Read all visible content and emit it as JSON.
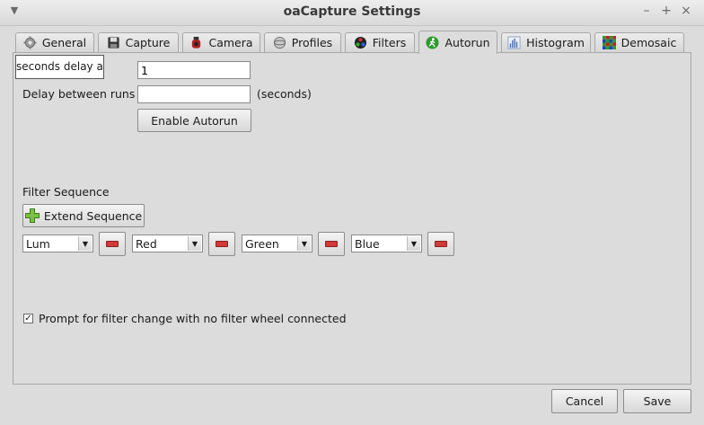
{
  "window": {
    "title": "oaCapture Settings"
  },
  "tabs": [
    {
      "label": "General",
      "icon": "gear-icon"
    },
    {
      "label": "Capture",
      "icon": "floppy-disk-icon"
    },
    {
      "label": "Camera",
      "icon": "camera-icon"
    },
    {
      "label": "Profiles",
      "icon": "profiles-icon"
    },
    {
      "label": "Filters",
      "icon": "filters-icon"
    },
    {
      "label": "Autorun",
      "icon": "autorun-icon"
    },
    {
      "label": "Histogram",
      "icon": "histogram-icon"
    },
    {
      "label": "Demosaic",
      "icon": "demosaic-icon"
    }
  ],
  "active_tab": "Autorun",
  "autorun": {
    "count_tooltip": "seconds delay af",
    "count_value": "1",
    "delay_label": "Delay between runs",
    "delay_value": "",
    "delay_units": "(seconds)",
    "enable_button": "Enable Autorun",
    "filter_sequence_label": "Filter Sequence",
    "extend_button": "Extend Sequence",
    "filters": [
      "Lum",
      "Red",
      "Green",
      "Blue"
    ],
    "prompt_checkbox_label": "Prompt for filter change with no filter wheel connected",
    "prompt_checked": true
  },
  "footer": {
    "cancel": "Cancel",
    "save": "Save"
  }
}
